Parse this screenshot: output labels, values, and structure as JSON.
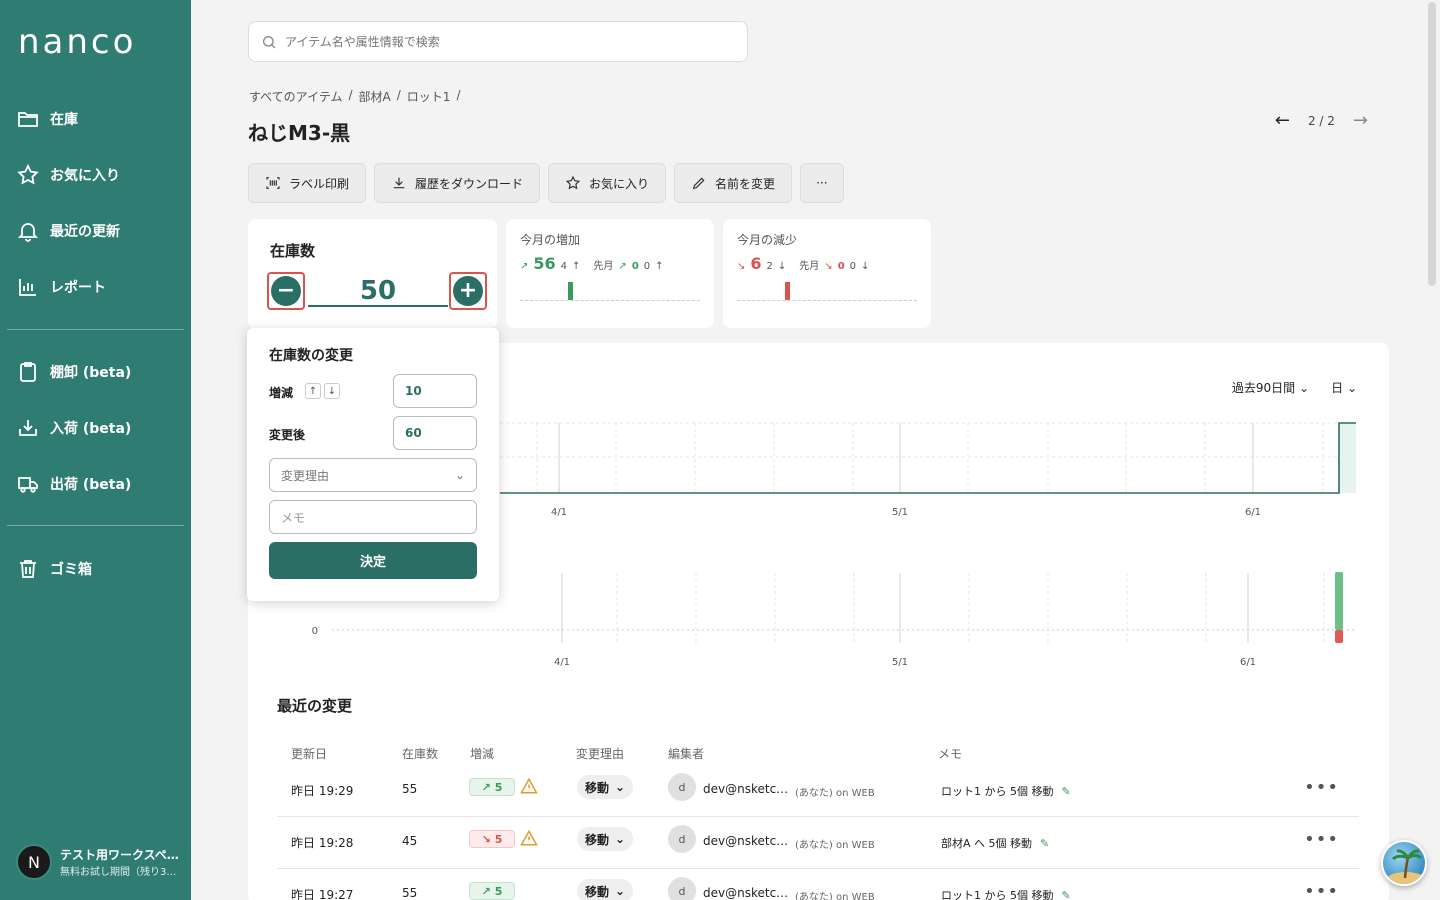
{
  "app": {
    "logo": "nanco"
  },
  "sidebar": {
    "items": [
      {
        "label": "在庫",
        "icon": "folder-icon"
      },
      {
        "label": "お気に入り",
        "icon": "star-icon"
      },
      {
        "label": "最近の更新",
        "icon": "bell-icon"
      },
      {
        "label": "レポート",
        "icon": "bar-chart-icon"
      },
      {
        "label": "棚卸 (beta)",
        "icon": "clipboard-icon"
      },
      {
        "label": "入荷 (beta)",
        "icon": "inbox-in-icon"
      },
      {
        "label": "出荷 (beta)",
        "icon": "truck-icon"
      },
      {
        "label": "ゴミ箱",
        "icon": "trash-icon"
      }
    ],
    "workspace": {
      "avatar": "N",
      "name": "テスト用ワークスペ…",
      "sub": "無料お試し期間（残り3…"
    }
  },
  "search": {
    "placeholder": "アイテム名や属性情報で検索"
  },
  "breadcrumb": [
    "すべてのアイテム",
    "/",
    "部材A",
    "/",
    "ロット1",
    "/"
  ],
  "item": {
    "title": "ねじM3-黒"
  },
  "pager": {
    "text": "2 / 2"
  },
  "toolbar": {
    "label_print": "ラベル印刷",
    "download_history": "履歴をダウンロード",
    "favorite": "お気に入り",
    "rename": "名前を変更",
    "more": "···"
  },
  "stock": {
    "label": "在庫数",
    "value": "50",
    "minus": "−",
    "plus": "+"
  },
  "increase": {
    "title": "今月の増加",
    "value": "56",
    "count": "4",
    "prev_label": "先月",
    "prev_value": "0",
    "prev_count": "0"
  },
  "decrease": {
    "title": "今月の減少",
    "value": "6",
    "count": "2",
    "prev_label": "先月",
    "prev_value": "0",
    "prev_count": "0"
  },
  "chart": {
    "period": "過去90日間",
    "unit": "日",
    "x_ticks": [
      "4/1",
      "5/1",
      "6/1"
    ],
    "lower_y_tick": "0"
  },
  "popup": {
    "title": "在庫数の変更",
    "delta_label": "増減",
    "delta_value": "10",
    "after_label": "変更後",
    "after_value": "60",
    "reason_placeholder": "変更理由",
    "memo_placeholder": "メモ",
    "submit": "決定"
  },
  "recent": {
    "title": "最近の変更",
    "headers": [
      "更新日",
      "在庫数",
      "増減",
      "変更理由",
      "編集者",
      "メモ"
    ],
    "rows": [
      {
        "date": "昨日 19:29",
        "stock": "55",
        "delta": "5",
        "dir": "up",
        "reason": "移動",
        "avatar": "d",
        "editor": "dev@nsketc…",
        "meta": "(あなた)  on WEB",
        "memo": "ロット1 から 5個 移動"
      },
      {
        "date": "昨日 19:28",
        "stock": "45",
        "delta": "5",
        "dir": "down",
        "reason": "移動",
        "avatar": "d",
        "editor": "dev@nsketc…",
        "meta": "(あなた)  on WEB",
        "memo": "部材A へ 5個 移動"
      },
      {
        "date": "昨日 19:27",
        "stock": "55",
        "delta": "5",
        "dir": "up",
        "reason": "移動",
        "avatar": "d",
        "editor": "dev@nsketc…",
        "meta": "(あなた)  on WEB",
        "memo": "ロット1 から 5個 移動"
      }
    ]
  },
  "colors": {
    "sidebar": "#2f7c73",
    "accent": "#2b6e66",
    "increase": "#3a9a5c",
    "decrease": "#d9534f"
  }
}
